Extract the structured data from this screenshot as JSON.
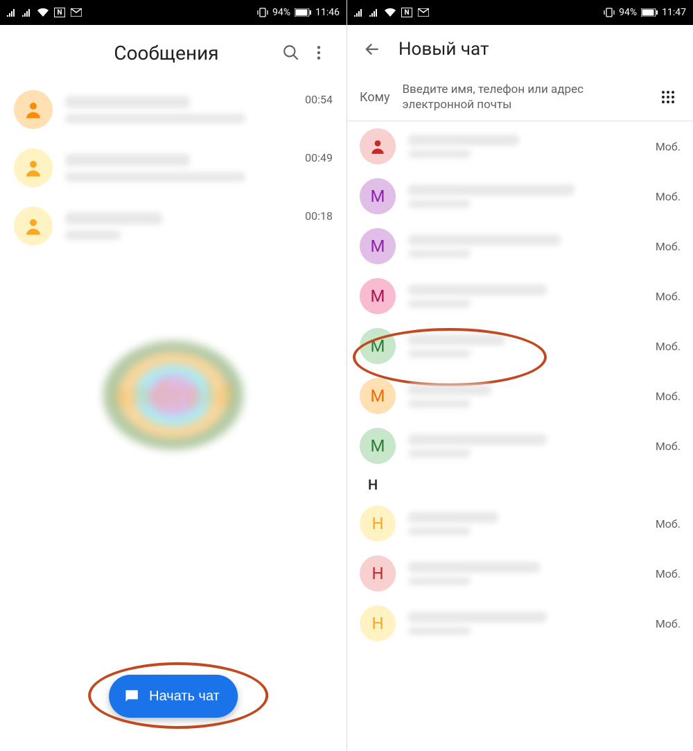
{
  "left": {
    "status": {
      "battery": "94%",
      "time": "11:46",
      "nfc": "N",
      "mail": "M"
    },
    "title": "Сообщения",
    "conversations": [
      {
        "time": "00:54"
      },
      {
        "time": "00:49"
      },
      {
        "time": "00:18"
      }
    ],
    "fab_label": "Начать чат"
  },
  "right": {
    "status": {
      "battery": "94%",
      "time": "11:47",
      "nfc": "N",
      "mail": "M"
    },
    "title": "Новый чат",
    "to_label": "Кому",
    "to_placeholder": "Введите имя, телефон или адрес электронной почты",
    "contact_type_label": "Моб.",
    "contacts": [
      {
        "avatar_color": "pink",
        "initial": "👤",
        "type": "Моб."
      },
      {
        "avatar_color": "purple",
        "initial": "M",
        "type": "Моб."
      },
      {
        "avatar_color": "purple",
        "initial": "M",
        "type": "Моб."
      },
      {
        "avatar_color": "rose",
        "initial": "M",
        "type": "Моб."
      },
      {
        "avatar_color": "green",
        "initial": "M",
        "type": "Моб."
      },
      {
        "avatar_color": "amber",
        "initial": "M",
        "type": "Моб."
      },
      {
        "avatar_color": "green",
        "initial": "M",
        "type": "Моб."
      }
    ],
    "section_letter": "Н",
    "contacts_n": [
      {
        "avatar_color": "yellowc",
        "initial": "Н",
        "type": "Моб."
      },
      {
        "avatar_color": "pink",
        "initial": "Н",
        "type": "Моб."
      },
      {
        "avatar_color": "yellowc",
        "initial": "Н",
        "type": "Моб."
      }
    ]
  }
}
